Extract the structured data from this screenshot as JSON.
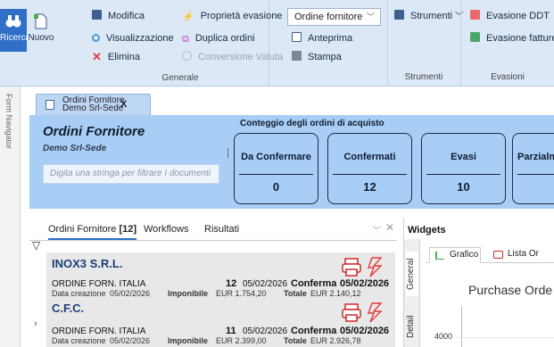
{
  "ribbon": {
    "ricerca": "Ricerca",
    "nuovo": "Nuovo",
    "modifica": "Modifica",
    "visualizzazione": "Visualizzazione",
    "elimina": "Elimina",
    "proprieta_evasione": "Proprietà evasione",
    "duplica_ordini": "Duplica ordini",
    "conversione_valuta": "Conversione Valuta",
    "combo_value": "Ordine fornitore",
    "anteprima": "Anteprima",
    "stampa": "Stampa",
    "strumenti_btn": "Strumenti",
    "evasione_ddt": "Evasione DDT",
    "evasione_fatture": "Evasione fatture",
    "groups": {
      "generale": "Generale",
      "strumenti": "Strumenti",
      "evasioni": "Evasioni"
    }
  },
  "left_strip": {
    "text": "Form Navigator"
  },
  "doc_tab": {
    "line1": "Ordini Fornitore",
    "line2": "Demo Srl-Sede",
    "close": "X"
  },
  "panel": {
    "title": "Ordini Fornitore",
    "subtitle": "Demo Srl-Sede",
    "filter_placeholder": "Digita una stringa per filtrare I documenti",
    "count_title": "Conteggio degli ordini di acquisto",
    "counts": [
      {
        "label": "Da Confermare",
        "value": "0"
      },
      {
        "label": "Confermati",
        "value": "12"
      },
      {
        "label": "Evasi",
        "value": "10"
      },
      {
        "label": "Parzialm",
        "value": ""
      }
    ]
  },
  "list": {
    "tabs": {
      "ordini": "Ordini Fornitore",
      "ordini_count": "[12]",
      "workflows": "Workflows",
      "risultati": "Risultati"
    },
    "orders": [
      {
        "name": "INOX3 S.R.L.",
        "type": "ORDINE FORN. ITALIA",
        "num": "12",
        "date": "05/02/2026",
        "stato": "Conferma",
        "stato_date": "05/02/2026",
        "creazione_label": "Data creazione",
        "creazione": "05/02/2026",
        "imponibile_label": "Imponibile",
        "imponibile": "EUR 1.754,20",
        "totale_label": "Totale",
        "totale": "EUR 2.140,12"
      },
      {
        "name": "C.F.C.",
        "type": "ORDINE FORN. ITALIA",
        "num": "11",
        "date": "05/02/2026",
        "stato": "Conferma",
        "stato_date": "05/02/2026",
        "creazione_label": "Data creazione",
        "creazione": "05/02/2026",
        "imponibile_label": "Imponibile",
        "imponibile": "EUR 2.399,00",
        "totale_label": "Totale",
        "totale": "EUR 2.926,78"
      }
    ]
  },
  "widgets": {
    "title": "Widgets",
    "side_tabs": {
      "general": "General",
      "detail": "Detail"
    },
    "tabs": {
      "grafico": "Grafico",
      "lista": "Lista Or"
    },
    "chart_title": "Purchase Orde",
    "tick": "4000"
  },
  "colors": {
    "ribbon_bg": "#dce8f6",
    "panel_bg": "#a9cef6",
    "accent": "#2f6fc7",
    "order_name": "#1d3e76",
    "pdf_red": "#e23b3b"
  }
}
